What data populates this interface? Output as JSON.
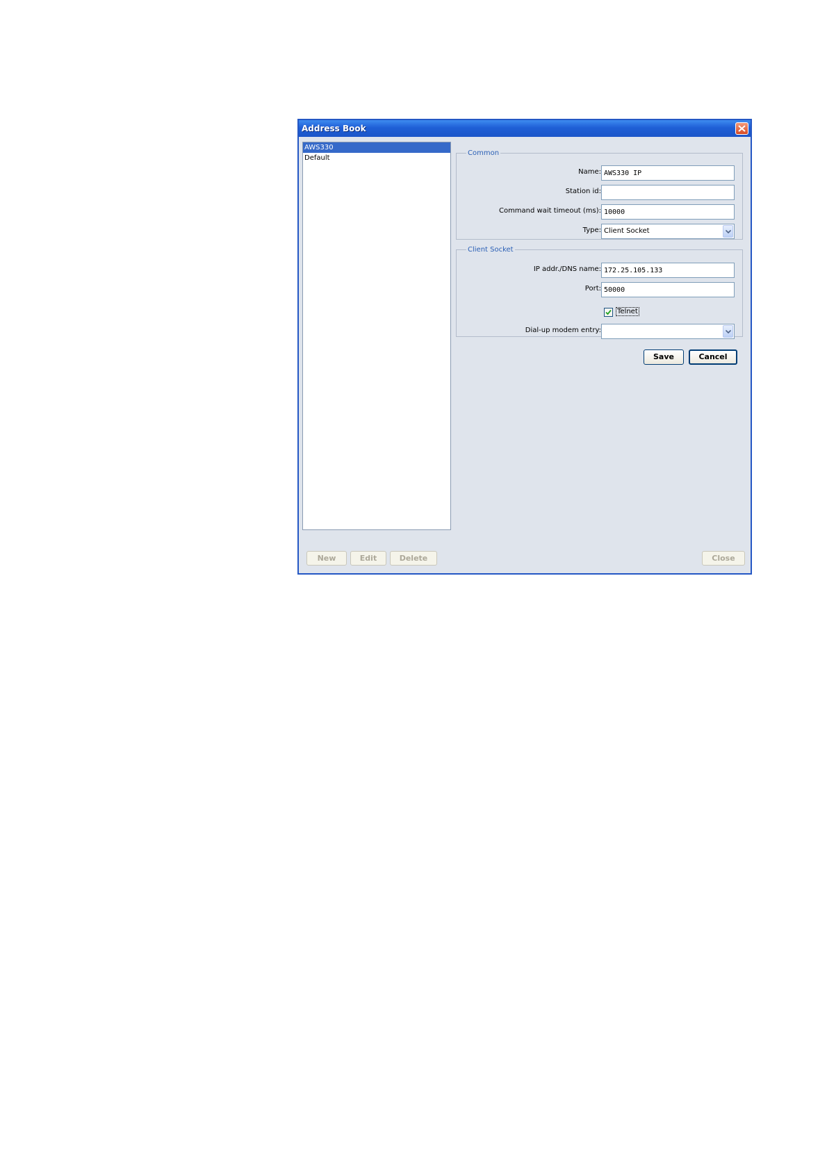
{
  "window": {
    "title": "Address Book"
  },
  "list": {
    "items": [
      "AWS330",
      "Default"
    ],
    "selected": "AWS330"
  },
  "common": {
    "legend": "Common",
    "name_label": "Name:",
    "name_value": "AWS330 IP",
    "station_label": "Station id:",
    "station_value": "",
    "timeout_label": "Command wait timeout (ms):",
    "timeout_value": "10000",
    "type_label": "Type:",
    "type_value": "Client Socket"
  },
  "socket": {
    "legend": "Client Socket",
    "ip_label": "IP addr./DNS name:",
    "ip_value": "172.25.105.133",
    "port_label": "Port:",
    "port_value": "50000",
    "telnet_label": "Telnet",
    "telnet_checked": true,
    "dialup_label": "Dial-up modem entry:",
    "dialup_value": ""
  },
  "buttons": {
    "save": "Save",
    "cancel": "Cancel",
    "new": "New",
    "edit": "Edit",
    "delete": "Delete",
    "close": "Close"
  },
  "colors": {
    "titlebar": "#1f5fd6",
    "selection": "#3569c9",
    "window_bg": "#dfe4ec",
    "legend": "#2a5fb5"
  }
}
